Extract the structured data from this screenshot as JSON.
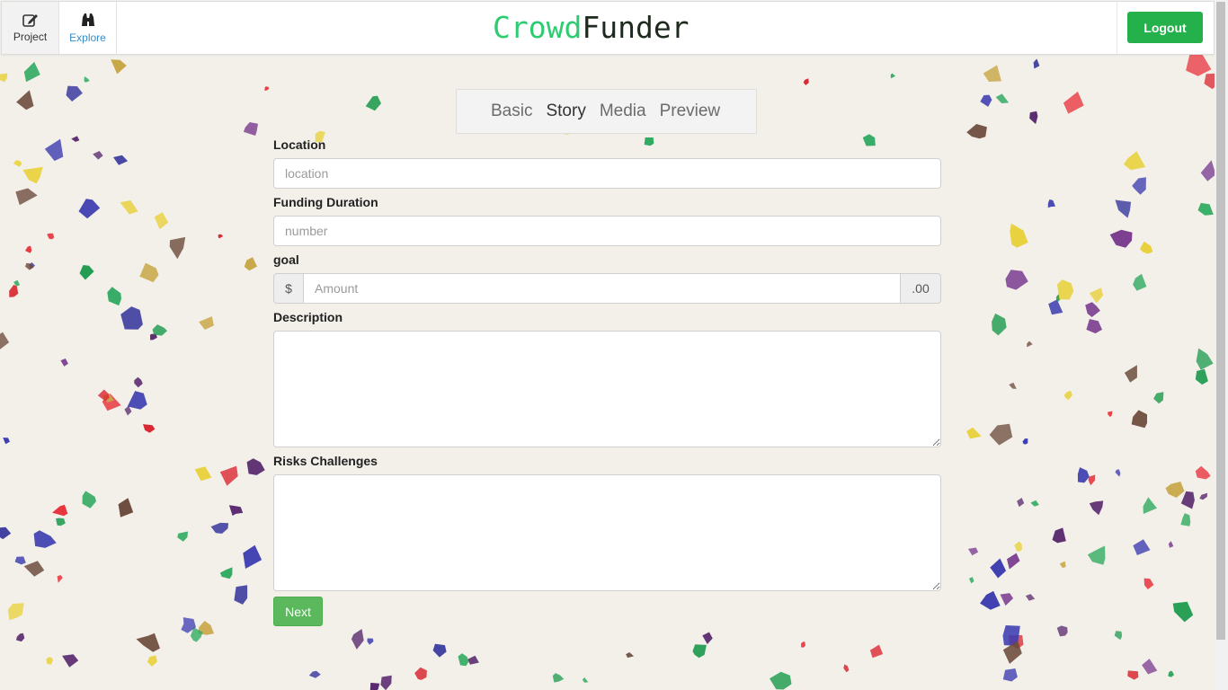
{
  "nav": {
    "project_label": "Project",
    "explore_label": "Explore",
    "brand_part1": "Crowd",
    "brand_part2": "Funder",
    "logout_label": "Logout"
  },
  "steps": [
    "Basic",
    "Story",
    "Media",
    "Preview"
  ],
  "active_step": "Story",
  "form": {
    "location_label": "Location",
    "location_placeholder": "location",
    "duration_label": "Funding Duration",
    "duration_placeholder": "number",
    "goal_label": "goal",
    "goal_prefix": "$",
    "goal_placeholder": "Amount",
    "goal_suffix": ".00",
    "description_label": "Description",
    "risks_label": "Risks Challenges",
    "next_label": "Next"
  },
  "colors": {
    "brand_green": "#2ecc71",
    "logout_bg": "#24b14c",
    "next_bg": "#5cb85c",
    "explore_link": "#3a8dc9"
  }
}
